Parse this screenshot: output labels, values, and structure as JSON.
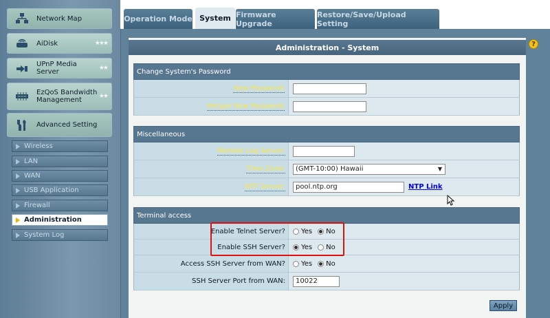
{
  "sidebar": {
    "main_items": [
      {
        "label": "Network Map",
        "icon": "network-map-icon"
      },
      {
        "label": "AiDisk",
        "icon": "aidisk-icon"
      },
      {
        "label": "UPnP Media Server",
        "icon": "media-server-icon"
      },
      {
        "label": "EzQoS Bandwidth Management",
        "icon": "qos-icon"
      },
      {
        "label": "Advanced Setting",
        "icon": "advanced-setting-icon"
      }
    ],
    "sub_items": [
      {
        "label": "Wireless"
      },
      {
        "label": "LAN"
      },
      {
        "label": "WAN"
      },
      {
        "label": "USB Application"
      },
      {
        "label": "Firewall"
      },
      {
        "label": "Administration"
      },
      {
        "label": "System Log"
      }
    ],
    "active_sub_item": "Administration"
  },
  "tabs": [
    {
      "label": "Operation Mode"
    },
    {
      "label": "System"
    },
    {
      "label": "Firmware Upgrade"
    },
    {
      "label": "Restore/Save/Upload Setting"
    }
  ],
  "active_tab": "System",
  "panel": {
    "title": "Administration - System",
    "password_section": {
      "heading": "Change System's Password",
      "new_password_label": "New Password:",
      "new_password_value": "",
      "retype_password_label": "Retype New Password:",
      "retype_password_value": ""
    },
    "misc_section": {
      "heading": "Miscellaneous",
      "remote_log_label": "Remote Log Server:",
      "remote_log_value": "",
      "time_zone_label": "Time Zone:",
      "time_zone_value": "(GMT-10:00) Hawaii",
      "ntp_label": "NTP Server:",
      "ntp_value": "pool.ntp.org",
      "ntp_link": "NTP Link"
    },
    "terminal_section": {
      "heading": "Terminal access",
      "telnet_label": "Enable Telnet Server?",
      "telnet_selected": "No",
      "ssh_label": "Enable SSH Server?",
      "ssh_selected": "Yes",
      "ssh_wan_label": "Access SSH Server from WAN?",
      "ssh_wan_selected": "No",
      "ssh_port_label": "SSH Server Port from WAN:",
      "ssh_port_value": "10022"
    },
    "yes_label": "Yes",
    "no_label": "No",
    "apply_label": "Apply"
  },
  "colors": {
    "highlight_box": "#e01010",
    "link": "#0000ee",
    "field_label_link": "#f9e84a"
  }
}
